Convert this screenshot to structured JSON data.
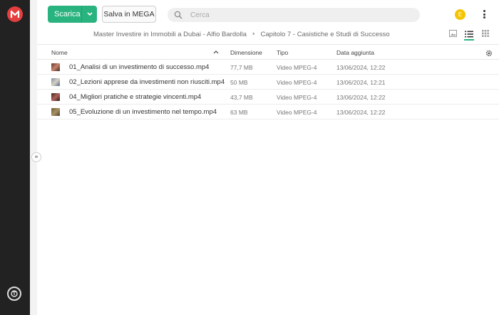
{
  "toolbar": {
    "download_label": "Scarica",
    "save_label": "Salva in MEGA",
    "search_placeholder": "Cerca",
    "avatar_initial": "E"
  },
  "breadcrumb": {
    "items": [
      "Master Investire in Immobili a Dubai - Alfio Bardolla",
      "Capitolo 7 - Casistiche e Studi di Successo"
    ]
  },
  "table": {
    "headers": {
      "name": "Nome",
      "size": "Dimensione",
      "type": "Tipo",
      "date": "Data aggiunta"
    },
    "rows": [
      {
        "name": "01_Analisi di un investimento di successo.mp4",
        "size": "77,7 MB",
        "type": "Video MPEG-4",
        "date": "13/06/2024, 12:22"
      },
      {
        "name": "02_Lezioni apprese da investimenti non riusciti.mp4",
        "size": "50 MB",
        "type": "Video MPEG-4",
        "date": "13/06/2024, 12:21"
      },
      {
        "name": "04_Migliori pratiche e strategie vincenti.mp4",
        "size": "43,7 MB",
        "type": "Video MPEG-4",
        "date": "13/06/2024, 12:22"
      },
      {
        "name": "05_Evoluzione di un investimento nel tempo.mp4",
        "size": "63 MB",
        "type": "Video MPEG-4",
        "date": "13/06/2024, 12:22"
      }
    ]
  },
  "icons": {
    "logo": "mega-logo",
    "search": "search-icon",
    "sort": "sort-ascending-icon",
    "settings": "gear-icon",
    "views": [
      "thumbnail-view-icon",
      "list-view-icon",
      "grid-view-icon"
    ]
  },
  "colors": {
    "accent": "#29b37e",
    "brand_red": "#e53e3e",
    "avatar": "#f5c400",
    "sidebar": "#222222"
  }
}
